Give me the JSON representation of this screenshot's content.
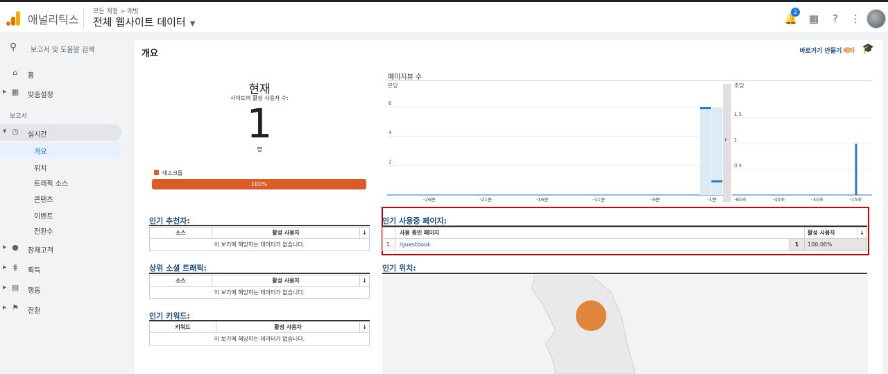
{
  "header": {
    "app_name": "애널리틱스",
    "breadcrumb": "모든 계정 > 래빗",
    "property": "전체 웹사이트 데이터",
    "notification_count": "2"
  },
  "sidebar": {
    "search_placeholder": "보고서 및 도움말 검색",
    "home": "홈",
    "custom": "맞춤설정",
    "reports_label": "보고서",
    "realtime": "실시간",
    "realtime_sub": [
      "개요",
      "위치",
      "트래픽 소스",
      "콘텐츠",
      "이벤트",
      "전환수"
    ],
    "audience": "잠재고객",
    "acquisition": "획득",
    "behavior": "행동",
    "conversions": "전환"
  },
  "main": {
    "title": "개요",
    "shortcut": "바로가기 만들기",
    "beta": "베타",
    "now": {
      "title": "현재",
      "subtitle": "사이트의 활성 사용자 수:",
      "count": "1",
      "unit": "명",
      "device_label": "데스크톱",
      "device_percent": "100%",
      "device_fraction": 1.0
    },
    "pageviews_title": "페이지뷰 수",
    "top_referrals": {
      "title": "인기 추천자:",
      "col_source": "소스",
      "col_active": "활성 사용자",
      "empty": "이 보기에 해당하는 데이터가 없습니다."
    },
    "top_social": {
      "title": "상위 소셜 트래픽:",
      "col_source": "소스",
      "col_active": "활성 사용자",
      "empty": "이 보기에 해당하는 데이터가 없습니다."
    },
    "top_keywords": {
      "title": "인기 키워드:",
      "col_keyword": "키워드",
      "col_active": "활성 사용자",
      "empty": "이 보기에 해당하는 데이터가 없습니다."
    },
    "top_pages": {
      "title": "인기 사용중 페이지:",
      "col_page": "사용 중인 페이지",
      "col_active": "활성 사용자",
      "rows": [
        {
          "rank": "1.",
          "page": "/guestbook",
          "count": "1",
          "percent": "100.00%"
        }
      ]
    },
    "top_locations": {
      "title": "인기 위치:"
    }
  },
  "chart_data": [
    {
      "type": "bar",
      "title": "분당",
      "x": [
        "-26분",
        "-21분",
        "-16분",
        "-11분",
        "-6분",
        "-1분"
      ],
      "y_ticks": [
        "2",
        "4",
        "6"
      ],
      "ylim": [
        0,
        7
      ],
      "highlight_values": [
        {
          "minute": -2,
          "value": 6
        },
        {
          "minute": -1,
          "value": 1
        }
      ]
    },
    {
      "type": "bar",
      "title": "초당",
      "x": [
        "-60초",
        "-45초",
        "-30초",
        "-15초"
      ],
      "y_ticks": [
        "0.5",
        "1",
        "1.5"
      ],
      "ylim": [
        0,
        2
      ],
      "values": [
        {
          "second": -15,
          "value": 1
        }
      ]
    }
  ]
}
